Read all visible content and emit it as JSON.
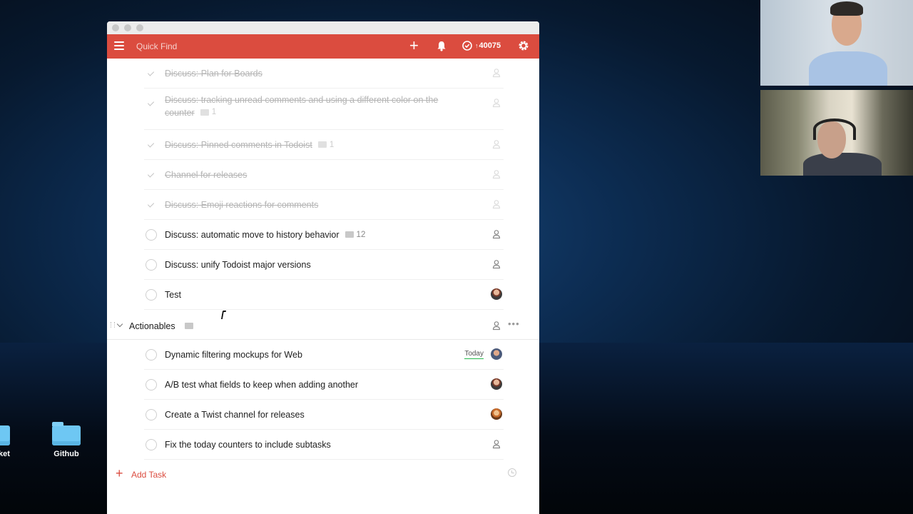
{
  "topbar": {
    "quick_find": "Quick Find",
    "karma": "40075",
    "accent_color": "#db4c3f"
  },
  "tasks": [
    {
      "text": "Discuss: Plan for Boards",
      "completed": true,
      "comments": ""
    },
    {
      "text": "Discuss: tracking unread comments and using a different color on the counter",
      "completed": true,
      "comments": "1"
    },
    {
      "text": "Discuss: Pinned comments in Todoist",
      "completed": true,
      "comments": "1"
    },
    {
      "text": "Channel for releases",
      "completed": true,
      "comments": ""
    },
    {
      "text": "Discuss: Emoji reactions for comments",
      "completed": true,
      "comments": ""
    },
    {
      "text": "Discuss: automatic move to history behavior",
      "completed": false,
      "comments": "12"
    },
    {
      "text": "Discuss: unify Todoist major versions",
      "completed": false,
      "comments": ""
    },
    {
      "text": "Test",
      "completed": false,
      "comments": ""
    }
  ],
  "section": {
    "title": "Actionables"
  },
  "actionables": [
    {
      "text": "Dynamic filtering mockups for Web",
      "due": "Today"
    },
    {
      "text": "A/B test what fields to keep when adding another"
    },
    {
      "text": "Create a Twist channel for releases"
    },
    {
      "text": "Fix the today counters to include subtasks"
    }
  ],
  "add_task_label": "Add Task",
  "desktop": {
    "icon_partial_label": "ket",
    "icon_github_label": "Github"
  },
  "icons": [
    "menu-icon",
    "plus-icon",
    "bell-icon",
    "karma-icon",
    "gear-icon",
    "comment-icon",
    "assign-icon",
    "history-icon",
    "folder-icon"
  ]
}
